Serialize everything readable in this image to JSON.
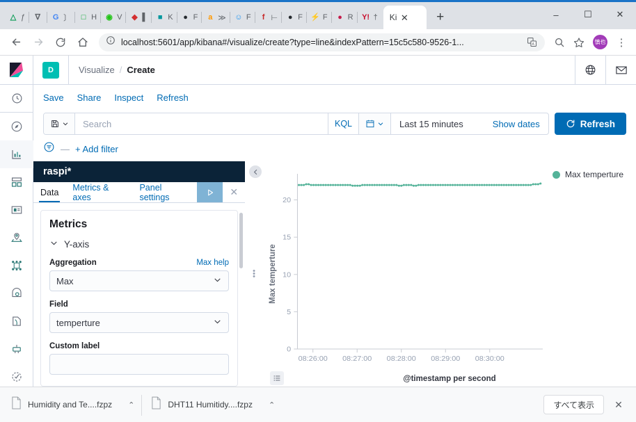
{
  "browser": {
    "pinned_tabs": [
      {
        "name": "google-drive",
        "glyph": "△",
        "color": "#0f9d58",
        "letter": "ƒ"
      },
      {
        "name": "gmail-filter",
        "glyph": "∇",
        "color": "#5f6368",
        "letter": ""
      },
      {
        "name": "google",
        "glyph": "G",
        "color": "#4285F4",
        "letter": "〕"
      },
      {
        "name": "evernote",
        "glyph": "□",
        "color": "#00A82D",
        "letter": "H"
      },
      {
        "name": "open-green",
        "glyph": "◉",
        "color": "#22c417",
        "letter": "V"
      },
      {
        "name": "stack-red",
        "glyph": "◆",
        "color": "#d32f2f",
        "letter": "▌"
      },
      {
        "name": "arduino",
        "glyph": "■",
        "color": "#00979D",
        "letter": "K"
      },
      {
        "name": "github-1",
        "glyph": "●",
        "color": "#24292e",
        "letter": "F"
      },
      {
        "name": "amazon",
        "glyph": "a",
        "color": "#FF9900",
        "letter": "≫"
      },
      {
        "name": "smile-blue",
        "glyph": "☺",
        "color": "#2196F3",
        "letter": "F"
      },
      {
        "name": "f-red",
        "glyph": "f",
        "color": "#c62828",
        "letter": "⊢"
      },
      {
        "name": "github-2",
        "glyph": "●",
        "color": "#24292e",
        "letter": "F"
      },
      {
        "name": "flash-black",
        "glyph": "⚡",
        "color": "#111111",
        "letter": "F"
      },
      {
        "name": "raspberry-pi",
        "glyph": "●",
        "color": "#C51A4A",
        "letter": "R"
      },
      {
        "name": "yahoo",
        "glyph": "Y!",
        "color": "#c8102e",
        "letter": "†"
      }
    ],
    "active_tab": {
      "title": "Ki",
      "close_label": "✕"
    },
    "new_tab_label": "+",
    "window_controls": {
      "minimize": "–",
      "maximize": "☐",
      "close": "✕"
    },
    "nav": {
      "back": "←",
      "forward": "→",
      "reload": "⟳",
      "home": "⌂"
    },
    "url": "localhost:5601/app/kibana#/visualize/create?type=line&indexPattern=15c5c580-9526-1...",
    "url_placeholder": "Search Google or type a URL",
    "site_info_icon": "ⓘ",
    "translate_icon": "translate-icon",
    "zoom_icon": "⌕",
    "bookmark_icon": "☆",
    "profile_initials": "慎也",
    "menu_icon": "⋮"
  },
  "kibana": {
    "space_badge": "D",
    "breadcrumb": {
      "parent": "Visualize",
      "separator": "/",
      "current": "Create"
    },
    "header_icons": [
      {
        "name": "globe-icon",
        "glyph": "globe"
      },
      {
        "name": "mail-icon",
        "glyph": "envelope"
      }
    ],
    "sidenav": [
      {
        "name": "recently-viewed",
        "icon": "clock-icon",
        "active": false
      },
      {
        "name": "discover",
        "icon": "compass-icon",
        "active": false
      },
      {
        "name": "visualize",
        "icon": "bar-chart-icon",
        "active": true
      },
      {
        "name": "dashboard",
        "icon": "dashboard-icon",
        "active": false
      },
      {
        "name": "canvas",
        "icon": "presentation-icon",
        "active": false
      },
      {
        "name": "maps",
        "icon": "map-marker-icon",
        "active": false
      },
      {
        "name": "machine-learning",
        "icon": "ml-nodes-icon",
        "active": false
      },
      {
        "name": "infrastructure",
        "icon": "eye-icon",
        "active": false
      },
      {
        "name": "logs",
        "icon": "logs-icon",
        "active": false
      },
      {
        "name": "apm",
        "icon": "apm-icon",
        "active": false
      },
      {
        "name": "uptime",
        "icon": "uptime-icon",
        "active": false
      },
      {
        "name": "collapse-nav",
        "icon": "arrow-right-icon",
        "active": false
      }
    ],
    "topnav": [
      "Save",
      "Share",
      "Inspect",
      "Refresh"
    ],
    "query": {
      "saved_query_icon": "save-icon",
      "search_value": "",
      "search_placeholder": "Search",
      "language": "KQL",
      "calendar_icon": "calendar-icon",
      "date_range": "Last 15 minutes",
      "show_dates": "Show dates",
      "refresh_label": "Refresh",
      "refresh_icon": "refresh-icon"
    },
    "filters": {
      "icon": "filter-icon",
      "dash": "—",
      "add_label": "+ Add filter"
    },
    "editor": {
      "index_title": "raspi*",
      "tabs": [
        {
          "label": "Data",
          "active": true
        },
        {
          "label": "Metrics & axes",
          "active": false
        },
        {
          "label": "Panel settings",
          "active": false
        }
      ],
      "apply_icon": "play-icon",
      "close_icon": "✕",
      "metrics_heading": "Metrics",
      "accordion_label": "Y-axis",
      "aggregation_label": "Aggregation",
      "aggregation_help": "Max help",
      "aggregation_value": "Max",
      "field_label": "Field",
      "field_value": "temperture",
      "custom_label_label": "Custom label",
      "custom_label_value": "",
      "collapse_icon": "chevron-left-circle-icon",
      "resize_handle": "drag-handle-icon"
    },
    "chart_toggle_icon": "legend-list-icon"
  },
  "chart_data": {
    "type": "line",
    "title": "",
    "xlabel": "@timestamp per second",
    "ylabel": "Max temperture",
    "ylim": [
      0,
      23.5
    ],
    "yticks": [
      0,
      5,
      10,
      15,
      20
    ],
    "xticks": [
      "08:26:00",
      "08:27:00",
      "08:28:00",
      "08:29:00",
      "08:30:00"
    ],
    "grid": false,
    "legend": {
      "position": "top-right",
      "entries": [
        {
          "name": "Max temperture",
          "color": "#54B399"
        }
      ]
    },
    "series": [
      {
        "name": "Max temperture",
        "color": "#54B399",
        "values": [
          22.0,
          22.0,
          22.0,
          22.1,
          22.1,
          22.0,
          22.0,
          22.0,
          22.0,
          22.0,
          22.0,
          22.0,
          22.0,
          22.0,
          22.0,
          22.0,
          22.0,
          22.0,
          22.0,
          22.0,
          22.0,
          22.0,
          21.9,
          21.9,
          21.9,
          21.9,
          22.0,
          22.0,
          22.0,
          22.0,
          22.0,
          22.0,
          22.0,
          22.0,
          22.0,
          22.0,
          22.0,
          22.0,
          22.0,
          22.0,
          22.0,
          21.9,
          21.9,
          22.0,
          22.0,
          22.0,
          22.0,
          21.9,
          21.9,
          22.0,
          22.0,
          22.0,
          22.0,
          22.0,
          22.0,
          22.0,
          22.0,
          22.0,
          22.0,
          22.0,
          22.0,
          22.0,
          22.0,
          22.0,
          22.0,
          22.0,
          22.0,
          22.0,
          22.0,
          22.0,
          22.0,
          22.0,
          22.0,
          22.0,
          22.0,
          22.0,
          22.0,
          22.0,
          22.0,
          22.0,
          22.0,
          22.0,
          22.0,
          22.0,
          22.0,
          22.0,
          22.0,
          22.0,
          22.0,
          22.0,
          22.0,
          22.0,
          22.0,
          22.0,
          22.0,
          22.0,
          22.1,
          22.1,
          22.1,
          22.2
        ]
      }
    ]
  },
  "downloads": {
    "items": [
      {
        "name": "Humidity and Te....fzpz",
        "icon": "file-icon",
        "caret": "⌃"
      },
      {
        "name": "DHT11 Humitidy....fzpz",
        "icon": "file-icon",
        "caret": "⌃"
      }
    ],
    "show_all": "すべて表示",
    "close": "✕"
  }
}
